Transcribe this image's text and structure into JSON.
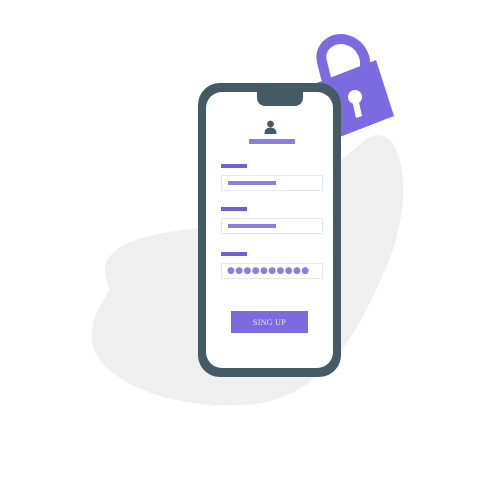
{
  "form": {
    "button_label": "SING UP",
    "password_mask": "●●●●●●●●●●"
  },
  "icons": [
    "user-icon",
    "padlock-icon"
  ],
  "colors": {
    "accent": "#7c6be0",
    "accent_light": "#8b7ee0",
    "phone_frame": "#455a64",
    "blob": "#efefef"
  }
}
